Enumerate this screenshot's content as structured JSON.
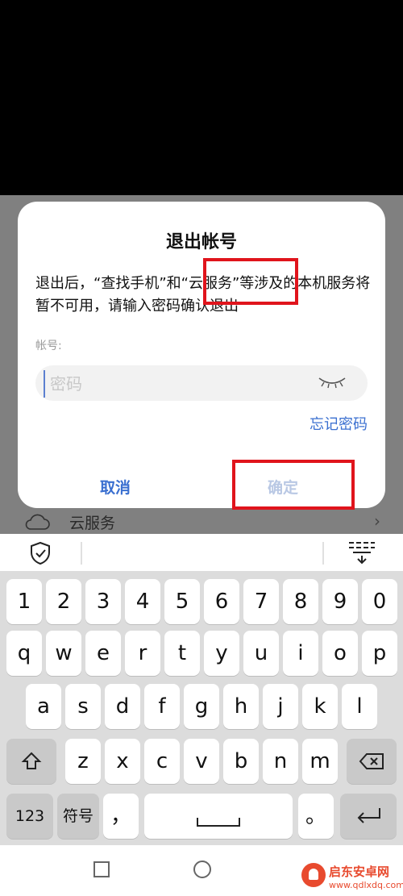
{
  "dialog": {
    "title": "退出帐号",
    "message": "退出后，“查找手机”和“云服务”等涉及的本机服务将暂不可用，请输入密码确认退出",
    "account_label": "帐号:",
    "password_placeholder": "密码",
    "forgot_password": "忘记密码",
    "cancel_label": "取消",
    "confirm_label": "确定"
  },
  "background_page": {
    "cloud_service_label": "云服务"
  },
  "keyboard": {
    "number_row": [
      "1",
      "2",
      "3",
      "4",
      "5",
      "6",
      "7",
      "8",
      "9",
      "0"
    ],
    "row1": [
      "q",
      "w",
      "e",
      "r",
      "t",
      "y",
      "u",
      "i",
      "o",
      "p"
    ],
    "row2": [
      "a",
      "s",
      "d",
      "f",
      "g",
      "h",
      "j",
      "k",
      "l"
    ],
    "row3": [
      "z",
      "x",
      "c",
      "v",
      "b",
      "n",
      "m"
    ],
    "num_label": "123",
    "symbol_label": "符号",
    "comma": "，",
    "period": "。"
  },
  "watermark": {
    "title": "启东安卓网",
    "url": "www.qdlxdq.com"
  },
  "colors": {
    "accent": "#3a6fd0",
    "highlight": "#e0141c",
    "watermark": "#e84a2e"
  }
}
